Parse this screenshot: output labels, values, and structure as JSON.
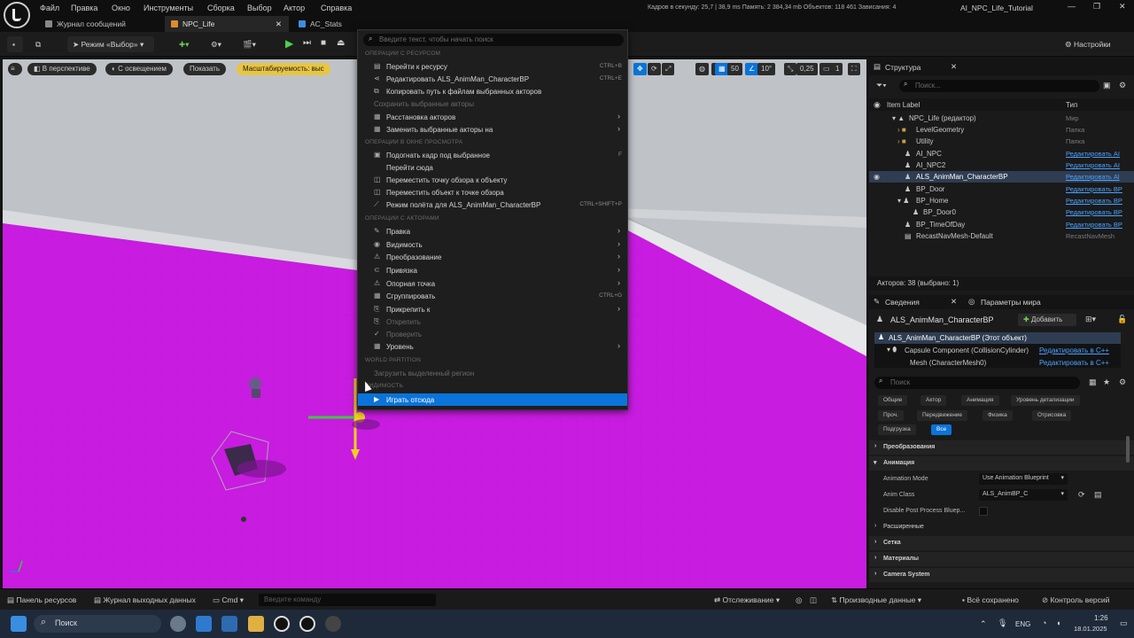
{
  "menubar": {
    "items": [
      "Файл",
      "Правка",
      "Окно",
      "Инструменты",
      "Сборка",
      "Выбор",
      "Актор",
      "Справка"
    ],
    "stats": "Кадров в секунду: 25,7  |  38,9 ms  Память: 2 384,34 mb  Объектов: 118 461  Зависания: 4",
    "project": "AI_NPC_Life_Tutorial"
  },
  "tabs": [
    {
      "label": "Журнал сообщений"
    },
    {
      "label": "NPC_Life"
    },
    {
      "label": "AC_Stats"
    }
  ],
  "toolbar": {
    "mode_label": "Режим «Выбор»",
    "settings_label": "Настройки"
  },
  "viewport": {
    "perspective_label": "В перспективе",
    "lit_label": "С освещением",
    "show_label": "Показать",
    "scalability_label": "Масштабируемость: выс",
    "snap_angle": "10°",
    "snap_grid": "50",
    "scale": "0,25",
    "cam_speed": "1"
  },
  "context_menu": {
    "search_placeholder": "Введите текст, чтобы начать поиск",
    "sections": {
      "assets": "Операции с ресурсом",
      "viewport": "Операции в окне просмотра",
      "actors": "Операции с акторами",
      "world_partition": "World Partition",
      "visibility": "Видимость"
    },
    "items": [
      {
        "label": "Перейти к ресурсу",
        "shortcut": "CTRL+B"
      },
      {
        "label": "Редактировать ALS_AnimMan_CharacterBP",
        "shortcut": "CTRL+E"
      },
      {
        "label": "Копировать путь к файлам выбранных акторов",
        "shortcut": ""
      },
      {
        "label": "Сохранить выбранные акторы",
        "shortcut": ""
      },
      {
        "label": "Расстановка акторов",
        "shortcut": ""
      },
      {
        "label": "Заменить выбранные акторы на",
        "shortcut": ""
      },
      {
        "label": "Подогнать кадр под выбранное",
        "shortcut": "F"
      },
      {
        "label": "Перейти сюда",
        "shortcut": ""
      },
      {
        "label": "Переместить точку обзора к объекту",
        "shortcut": ""
      },
      {
        "label": "Переместить объект к точке обзора",
        "shortcut": ""
      },
      {
        "label": "Режим полёта для ALS_AnimMan_CharacterBP",
        "shortcut": "CTRL+SHIFT+P"
      },
      {
        "label": "Правка",
        "shortcut": ""
      },
      {
        "label": "Видимость",
        "shortcut": ""
      },
      {
        "label": "Преобразование",
        "shortcut": ""
      },
      {
        "label": "Привязка",
        "shortcut": ""
      },
      {
        "label": "Опорная точка",
        "shortcut": ""
      },
      {
        "label": "Сгруппировать",
        "shortcut": "CTRL+G"
      },
      {
        "label": "Прикрепить к",
        "shortcut": ""
      },
      {
        "label": "Открепить",
        "shortcut": ""
      },
      {
        "label": "Проверить",
        "shortcut": ""
      },
      {
        "label": "Уровень",
        "shortcut": ""
      },
      {
        "label": "Загрузить выделенный регион",
        "shortcut": ""
      },
      {
        "label": "Играть отсюда",
        "shortcut": ""
      }
    ]
  },
  "outliner": {
    "title": "Структура",
    "search_placeholder": "Поиск...",
    "col_label": "Item Label",
    "col_type": "Тип",
    "rows": [
      {
        "label": "NPC_Life (редактор)",
        "type": "Мир"
      },
      {
        "label": "LevelGeometry",
        "type": "Папка"
      },
      {
        "label": "Utility",
        "type": "Папка"
      },
      {
        "label": "AI_NPC",
        "type": "Редактировать AI"
      },
      {
        "label": "AI_NPC2",
        "type": "Редактировать AI"
      },
      {
        "label": "ALS_AnimMan_CharacterBP",
        "type": "Редактировать Al"
      },
      {
        "label": "BP_Door",
        "type": "Редактировать BP"
      },
      {
        "label": "BP_Home",
        "type": "Редактировать BP"
      },
      {
        "label": "BP_Door0",
        "type": "Редактировать BP"
      },
      {
        "label": "BP_TimeOfDay",
        "type": "Редактировать BP"
      },
      {
        "label": "RecastNavMesh-Default",
        "type": "RecastNavMesh"
      }
    ],
    "actor_count": "Акторов: 38 (выбрано: 1)"
  },
  "details": {
    "tab_details": "Сведения",
    "tab_world": "Параметры мира",
    "actor_name": "ALS_AnimMan_CharacterBP",
    "add_label": "Добавить",
    "root_component": "ALS_AnimMan_CharacterBP (Этот объект)",
    "capsule_component": "Capsule Component (CollisionCylinder)",
    "capsule_link": "Редактировать в C++",
    "mesh_component": "Mesh (CharacterMesh0)",
    "mesh_link": "Редактировать в C++",
    "search_placeholder": "Поиск",
    "filters": [
      "Общие",
      "Актор",
      "Анимация",
      "Уровень детализации",
      "Проч.",
      "Передвижение",
      "Физика",
      "Отрисовка",
      "Подгрузка",
      "Все"
    ],
    "categories": [
      "Преобразования",
      "Анимация",
      "Расширенные",
      "Сетка",
      "Материалы",
      "Camera System"
    ],
    "props": {
      "anim_mode_label": "Animation Mode",
      "anim_mode_value": "Use Animation Blueprint",
      "anim_class_label": "Anim Class",
      "anim_class_value": "ALS_AnimBP_C",
      "disable_post_label": "Disable Post Process Bluep..."
    }
  },
  "statusbar": {
    "content_drawer": "Панель ресурсов",
    "output_log": "Журнал выходных данных",
    "cmd": "Cmd",
    "cmd_placeholder": "Введите команду",
    "tracking": "Отслеживание",
    "derived_data": "Производные данные",
    "all_saved": "Всё сохранено",
    "version_control": "Контроль версий"
  },
  "taskbar": {
    "search": "Поиск",
    "lang": "ENG",
    "time": "1:26",
    "date": "18.01.2025"
  },
  "colors": {
    "floor": "#c81ce0",
    "highlight": "#0a74da",
    "link": "#4aa3ff",
    "accent_yellow": "#e8c542"
  }
}
